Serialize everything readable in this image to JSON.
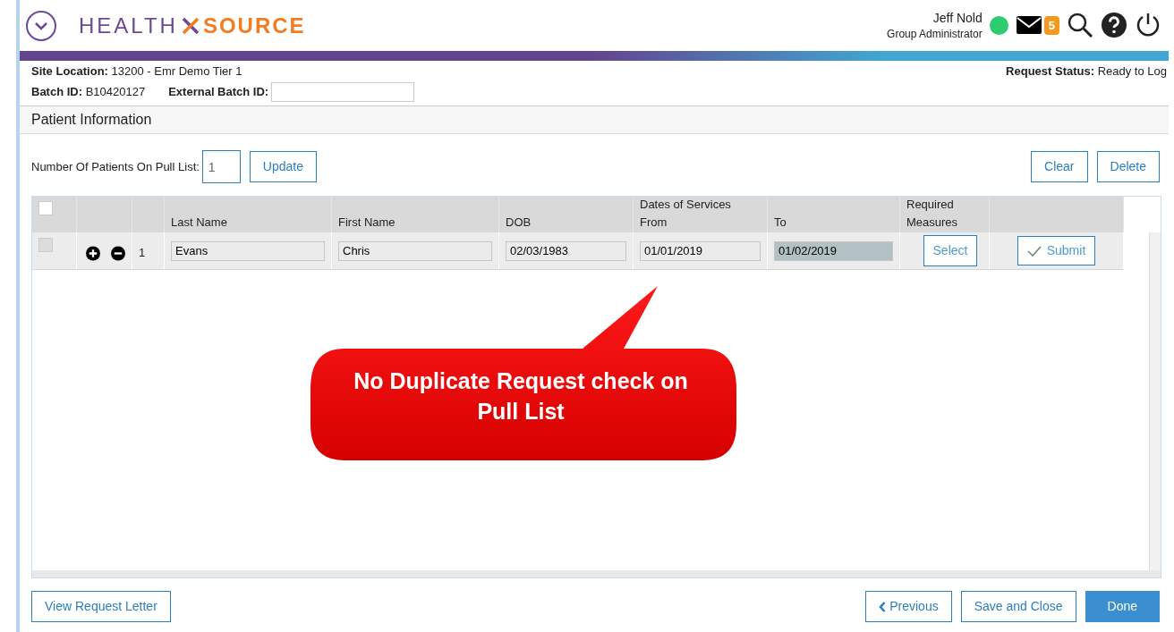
{
  "header": {
    "logo": {
      "part_1": "HEALTH",
      "part_2": "SOURCE"
    },
    "user": {
      "name": "Jeff Nold",
      "role": "Group Administrator",
      "online": true
    },
    "messages_badge": "5"
  },
  "request": {
    "site_location": {
      "label": "Site Location:",
      "value": "13200 - Emr Demo Tier 1"
    },
    "status": {
      "label": "Request Status:",
      "value": "Ready to Log"
    },
    "batch_id": {
      "label": "Batch ID:",
      "value": "B10420127"
    },
    "external_batch_id": {
      "label": "External Batch ID:"
    }
  },
  "section_title": "Patient Information",
  "pull_list": {
    "label": "Number Of Patients On Pull List:",
    "value": "1",
    "button": "Update"
  },
  "toolbar_buttons": [
    "Clear",
    "Delete"
  ],
  "table": {
    "all_checked": false,
    "columns": [
      {
        "label": "Last Name"
      },
      {
        "label": "First Name"
      },
      {
        "label": "DOB"
      },
      {
        "group": "Dates of Services",
        "label": "From"
      },
      {
        "label": "To"
      },
      {
        "label": "Required Measures"
      }
    ],
    "rows": [
      {
        "checked": false,
        "number": "1",
        "last_name": "Evans",
        "first_name": "Chris",
        "dob": "02/03/1983",
        "from": "01/01/2019",
        "to": "01/02/2019",
        "to_selected": true,
        "select_button": "Select",
        "submit_button": "Submit"
      }
    ]
  },
  "callout": {
    "text": "No Duplicate Request check on Pull List"
  },
  "footer": {
    "left_button": "View Request Letter",
    "buttons": [
      {
        "label": "Previous",
        "kind": "back"
      },
      {
        "label": "Save and Close",
        "kind": "default"
      },
      {
        "label": "Done",
        "kind": "primary"
      }
    ]
  }
}
